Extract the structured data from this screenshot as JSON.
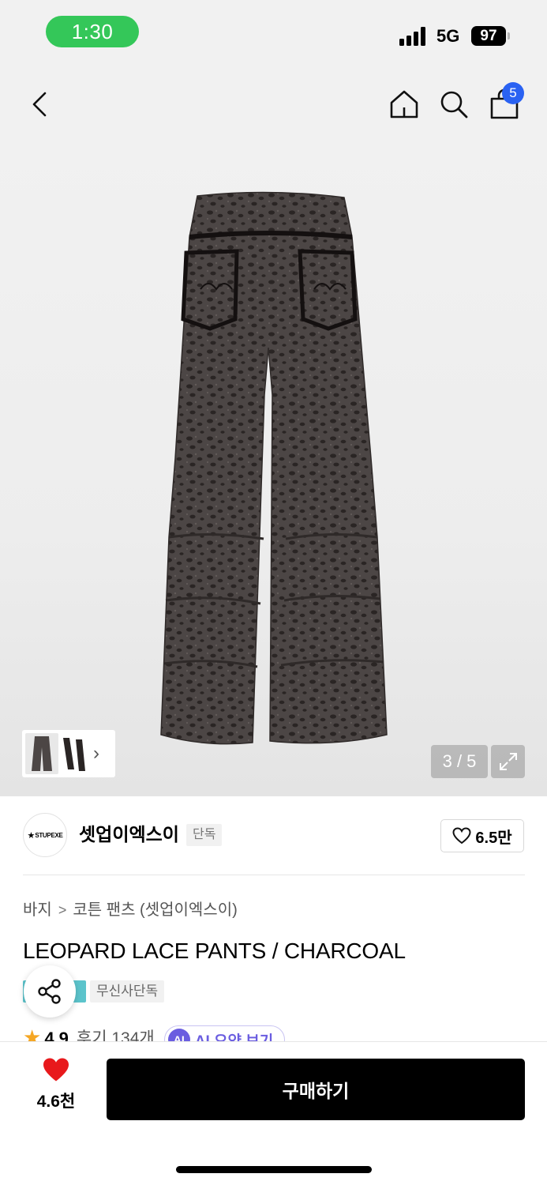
{
  "status_bar": {
    "time": "1:30",
    "network": "5G",
    "battery": "97"
  },
  "nav": {
    "cart_count": "5"
  },
  "gallery": {
    "page_indicator": "3 / 5",
    "thumbnail_arrow": "›"
  },
  "brand": {
    "logo_text": "STUPEXE",
    "name": "셋업이엑스이",
    "tag": "단독",
    "likes": "6.5만"
  },
  "product": {
    "breadcrumb": [
      "바지",
      "코튼 팬츠 (셋업이엑스이)"
    ],
    "breadcrumb_separator": ">",
    "title": "LEOPARD LACE PANTS / CHARCOAL",
    "badge": "무신사단독",
    "rating_star": "★",
    "rating": "4.9",
    "reviews": "후기 134개",
    "ai_icon": "AI",
    "ai_summary": "AI 요약 보기"
  },
  "bottom_bar": {
    "likes": "4.6천",
    "buy_label": "구매하기"
  },
  "colors": {
    "accent": "#2a62f2",
    "heart": "#e8191c",
    "status_green": "#34c759",
    "teal_badge": "#5cc4cc",
    "ai_purple": "#6a5de0"
  },
  "icons": [
    "back-icon",
    "home-icon",
    "search-icon",
    "cart-icon",
    "expand-icon",
    "heart-outline-icon",
    "share-icon",
    "star-icon",
    "heart-filled-icon"
  ]
}
